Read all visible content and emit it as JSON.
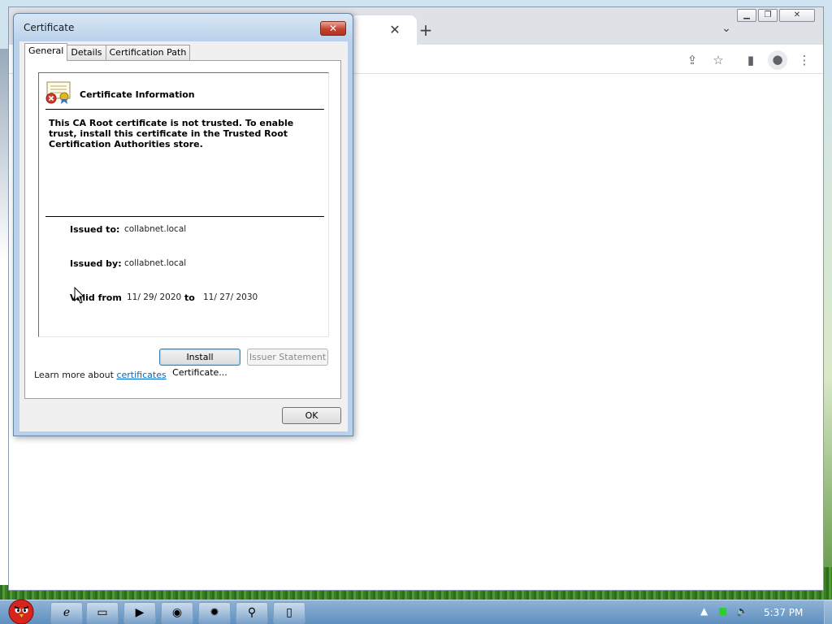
{
  "dialog": {
    "title": "Certificate",
    "close_glyph": "✕",
    "tabs": [
      {
        "label": "General",
        "active": true
      },
      {
        "label": "Details",
        "active": false
      },
      {
        "label": "Certification Path",
        "active": false
      }
    ],
    "info_title": "Certificate Information",
    "warning": "This CA Root certificate is not trusted. To enable trust, install this certificate in the Trusted Root Certification Authorities store.",
    "issued_to_label": "Issued to:",
    "issued_to_value": "collabnet.local",
    "issued_by_label": "Issued by:",
    "issued_by_value": "collabnet.local",
    "valid_from_label": "Valid from",
    "valid_from_value": "11/ 29/ 2020",
    "valid_to_label": "to",
    "valid_to_value": "11/ 27/ 2030",
    "install_button": "Install Certificate...",
    "issuer_button": "Issuer Statement",
    "learn_prefix": "Learn more about ",
    "learn_link": "certificates",
    "ok_button": "OK"
  },
  "browser": {
    "tab_close_glyph": "✕",
    "new_tab_glyph": "+",
    "tab_search_glyph": "⌄",
    "toolbar_icons": [
      "share-icon",
      "star-icon",
      "side-panel-icon",
      "profile-icon",
      "menu-icon"
    ]
  },
  "taskbar": {
    "apps": [
      "internet-explorer-icon",
      "folder-icon",
      "media-player-icon",
      "chrome-icon",
      "settings-icon",
      "network-icon",
      "document-icon"
    ],
    "clock": "5:37 PM"
  },
  "colors": {
    "dialog_frame": "#b9d1ea",
    "link": "#0066cc",
    "taskbar": "#6f9cc9"
  }
}
